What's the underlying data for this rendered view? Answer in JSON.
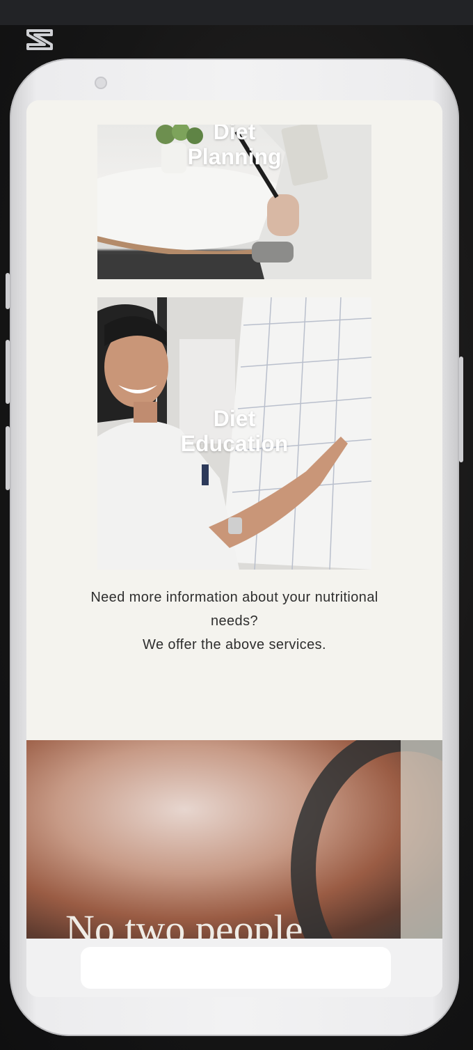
{
  "cards": [
    {
      "title_line1": "Diet",
      "title_line2": "Planning"
    },
    {
      "title_line1": "Diet",
      "title_line2": "Education"
    }
  ],
  "info": {
    "line1": "Need more information about your nutritional",
    "line2": "needs?",
    "line3": "We offer the above services."
  },
  "hero": {
    "text": "No two people"
  },
  "icons": {
    "app_logo": "capcut-logo-icon"
  }
}
